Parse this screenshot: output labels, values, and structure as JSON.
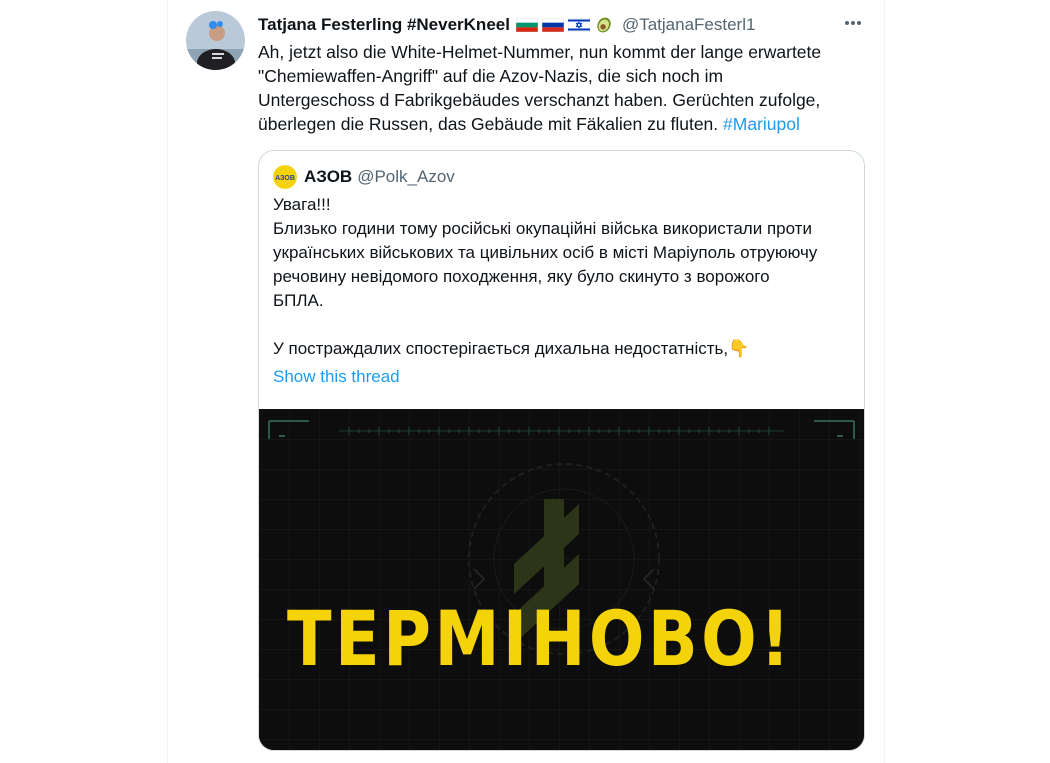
{
  "tweet": {
    "display_name": "Tatjana Festerling #NeverKneel",
    "handle": "@TatjanaFesterl1",
    "flags": [
      "bulgaria-flag",
      "russia-flag",
      "israel-flag",
      "avocado-emoji"
    ],
    "text_line_1": "Ah, jetzt also die White-Helmet-Nummer, nun kommt der lange erwartete",
    "text_line_2": "\"Chemiewaffen-Angriff\" auf die Azov-Nazis, die sich noch im",
    "text_line_3": "Untergeschoss d Fabrikgebäudes verschanzt haben. Gerüchten zufolge,",
    "text_line_4": "überlegen die Russen, das Gebäude mit Fäkalien zu fluten. ",
    "hashtag": "#Mariupol"
  },
  "quoted_tweet": {
    "avatar_text": "АЗОВ",
    "display_name": "АЗОВ",
    "handle": "@Polk_Azov",
    "line_1": "Увага!!!",
    "line_2": "Близько години тому російські окупаційні війська використали проти",
    "line_3": "українських військових та цивільних осіб в місті Маріуполь отруюючу",
    "line_4": "речовину невідомого походження, яку було скинуто з ворожого",
    "line_5": "БПЛА.",
    "line_6": "У постраждалих спостерігається дихальна недостатність,",
    "pointing_emoji": "👇",
    "show_thread": "Show this thread",
    "image_text": "ТЕРМІНОВО!"
  },
  "colors": {
    "accent": "#1d9bf0",
    "image_text": "#f5d30b",
    "image_background": "#0d0d0d"
  }
}
